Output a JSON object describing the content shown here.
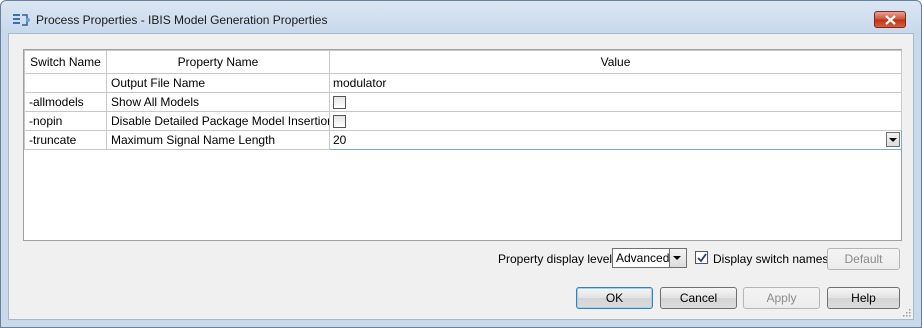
{
  "window": {
    "title": "Process Properties - IBIS Model Generation Properties"
  },
  "grid": {
    "columns": [
      "Switch Name",
      "Property Name",
      "Value"
    ],
    "rows": [
      {
        "switch": "",
        "property": "Output File Name",
        "value": "modulator",
        "kind": "text"
      },
      {
        "switch": "-allmodels",
        "property": "Show All Models",
        "value": "",
        "kind": "checkbox",
        "checked": false
      },
      {
        "switch": "-nopin",
        "property": "Disable Detailed Package Model Insertion",
        "value": "",
        "kind": "checkbox",
        "checked": false
      },
      {
        "switch": "-truncate",
        "property": "Maximum Signal Name Length",
        "value": "20",
        "kind": "combo"
      }
    ]
  },
  "options": {
    "level_label": "Property display level:",
    "level_value": "Advanced",
    "display_switch_label": "Display switch names",
    "display_switch_checked": true,
    "default_label": "Default"
  },
  "buttons": {
    "ok": "OK",
    "cancel": "Cancel",
    "apply": "Apply",
    "help": "Help"
  },
  "colors": {
    "close_button": "#cf5339",
    "focus_border": "#3c7fb1"
  }
}
